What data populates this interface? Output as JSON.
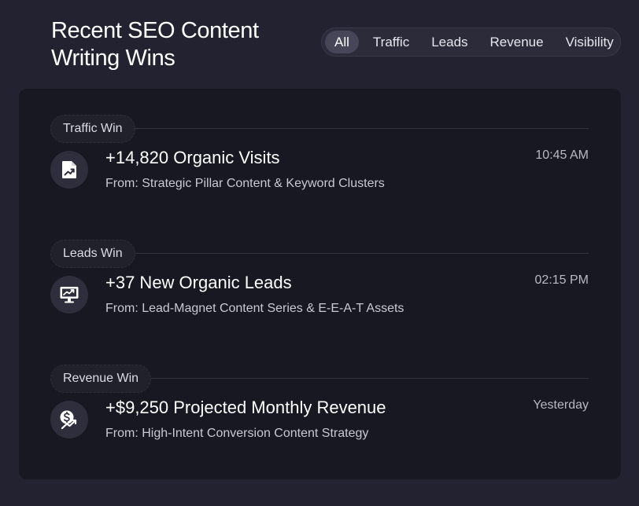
{
  "header": {
    "title": "Recent SEO Content Writing Wins"
  },
  "filters": [
    {
      "label": "All",
      "active": true
    },
    {
      "label": "Traffic",
      "active": false
    },
    {
      "label": "Leads",
      "active": false
    },
    {
      "label": "Revenue",
      "active": false
    },
    {
      "label": "Visibility",
      "active": false
    }
  ],
  "sections": [
    {
      "label": "Traffic Win",
      "icon": "document-chart-icon",
      "title": "+14,820 Organic Visits",
      "source": "From: Strategic Pillar Content & Keyword Clusters",
      "time": "10:45 AM"
    },
    {
      "label": "Leads Win",
      "icon": "monitor-chart-icon",
      "title": "+37 New Organic Leads",
      "source": "From: Lead-Magnet Content Series & E-E-A-T Assets",
      "time": "02:15 PM"
    },
    {
      "label": "Revenue Win",
      "icon": "dollar-growth-icon",
      "title": "+$9,250 Projected Monthly Revenue",
      "source": "From: High-Intent Conversion Content Strategy",
      "time": "Yesterday"
    }
  ]
}
